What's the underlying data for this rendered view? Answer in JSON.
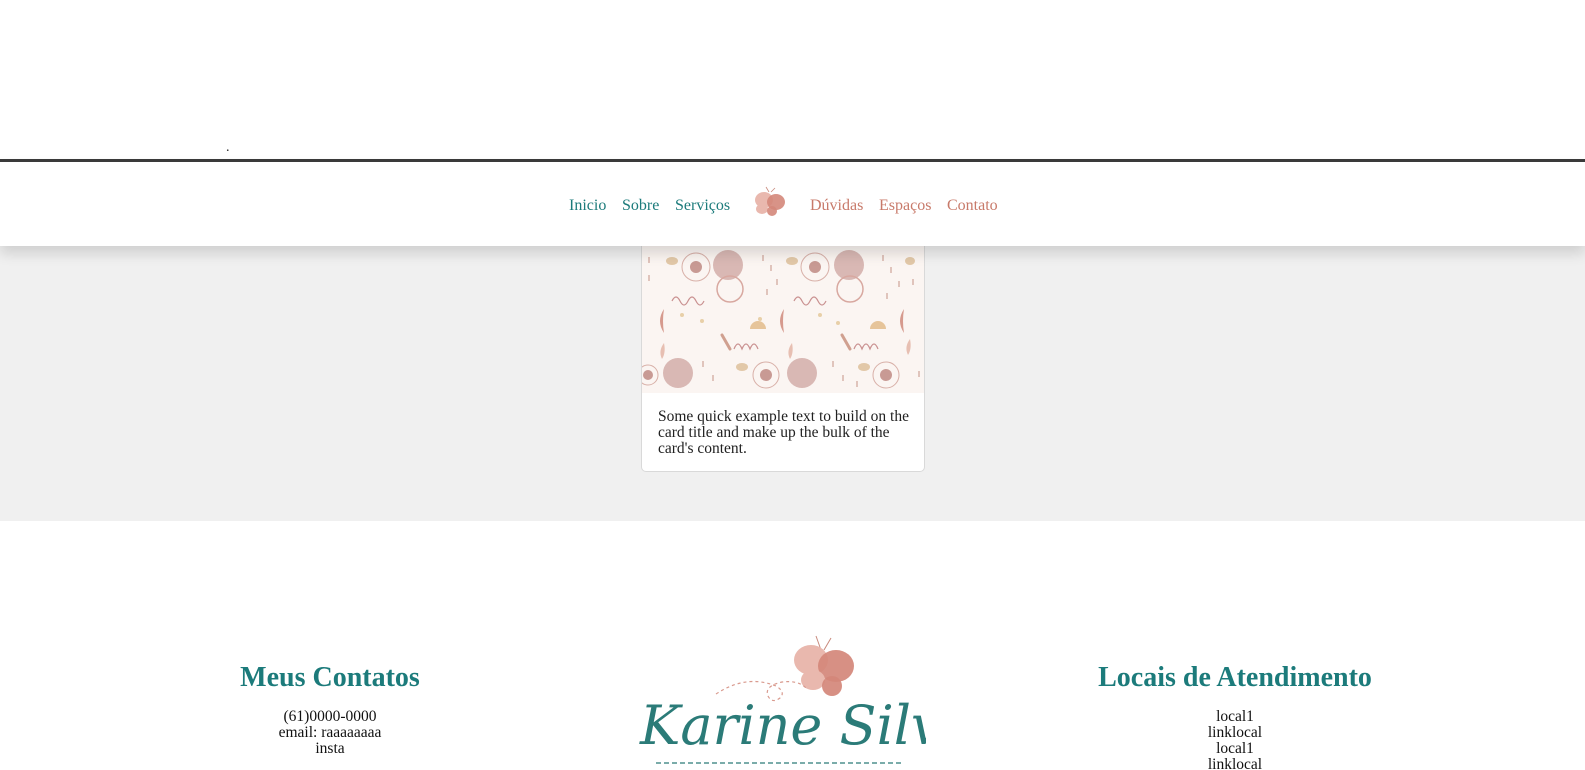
{
  "header": {
    "stray_mark": "."
  },
  "nav": {
    "left_items": [
      "Inicio",
      "Sobre",
      "Serviços"
    ],
    "right_items": [
      "Dúvidas",
      "Espaços",
      "Contato"
    ],
    "logo_icon": "butterfly-icon"
  },
  "card": {
    "image": "pastel-boho-pattern-image",
    "text": "Some quick example text to build on the card title and make up the bulk of the card's content."
  },
  "footer": {
    "contacts": {
      "title": "Meus Contatos",
      "items": [
        "(61)0000-0000",
        "email: raaaaaaaa",
        "insta"
      ]
    },
    "brand": {
      "logo_text": "Karine Silva"
    },
    "locations": {
      "title": "Locais de Atendimento",
      "items": [
        "local1",
        "linklocal",
        "local1",
        "linklocal"
      ]
    }
  },
  "colors": {
    "teal": "#1c7b7b",
    "rose": "#c87a6a",
    "band_gray": "#f0f0f0",
    "butterfly_light": "#e8b1a8",
    "butterfly_dark": "#d4877a"
  }
}
